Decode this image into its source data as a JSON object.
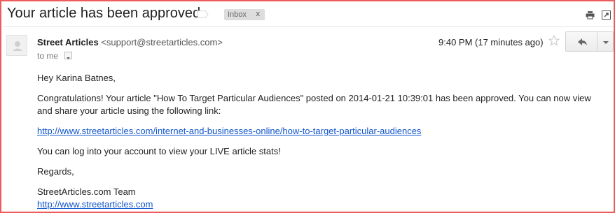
{
  "subject": "Your article has been approved",
  "label": {
    "name": "Inbox",
    "remove": "x"
  },
  "toolbar_icons": {
    "print": "print-icon",
    "new_window": "new-window-icon"
  },
  "message": {
    "sender_name": "Street Articles",
    "sender_email": "<support@streetarticles.com>",
    "recipient": "to me",
    "time": "9:40 PM (17 minutes ago)",
    "icons": {
      "star": "star-icon",
      "reply": "reply-icon",
      "more": "chevron-down-icon",
      "avatar": "avatar-icon"
    }
  },
  "body": {
    "greeting": "Hey Karina Batnes,",
    "paragraph1": "Congratulations!  Your article \"How To Target Particular Audiences\" posted on 2014-01-21 10:39:01 has been approved.  You can now view and share your article using the following link:",
    "article_link": "http://www.streetarticles.com/internet-and-businesses-online/how-to-target-particular-audiences",
    "paragraph2": "You can log into your account to view your LIVE article stats!",
    "closing": "Regards,",
    "signature_name": "StreetArticles.com Team",
    "signature_link": "http://www.streetarticles.com"
  },
  "colors": {
    "link": "#1155cc",
    "frame": "#ef5a5a"
  }
}
